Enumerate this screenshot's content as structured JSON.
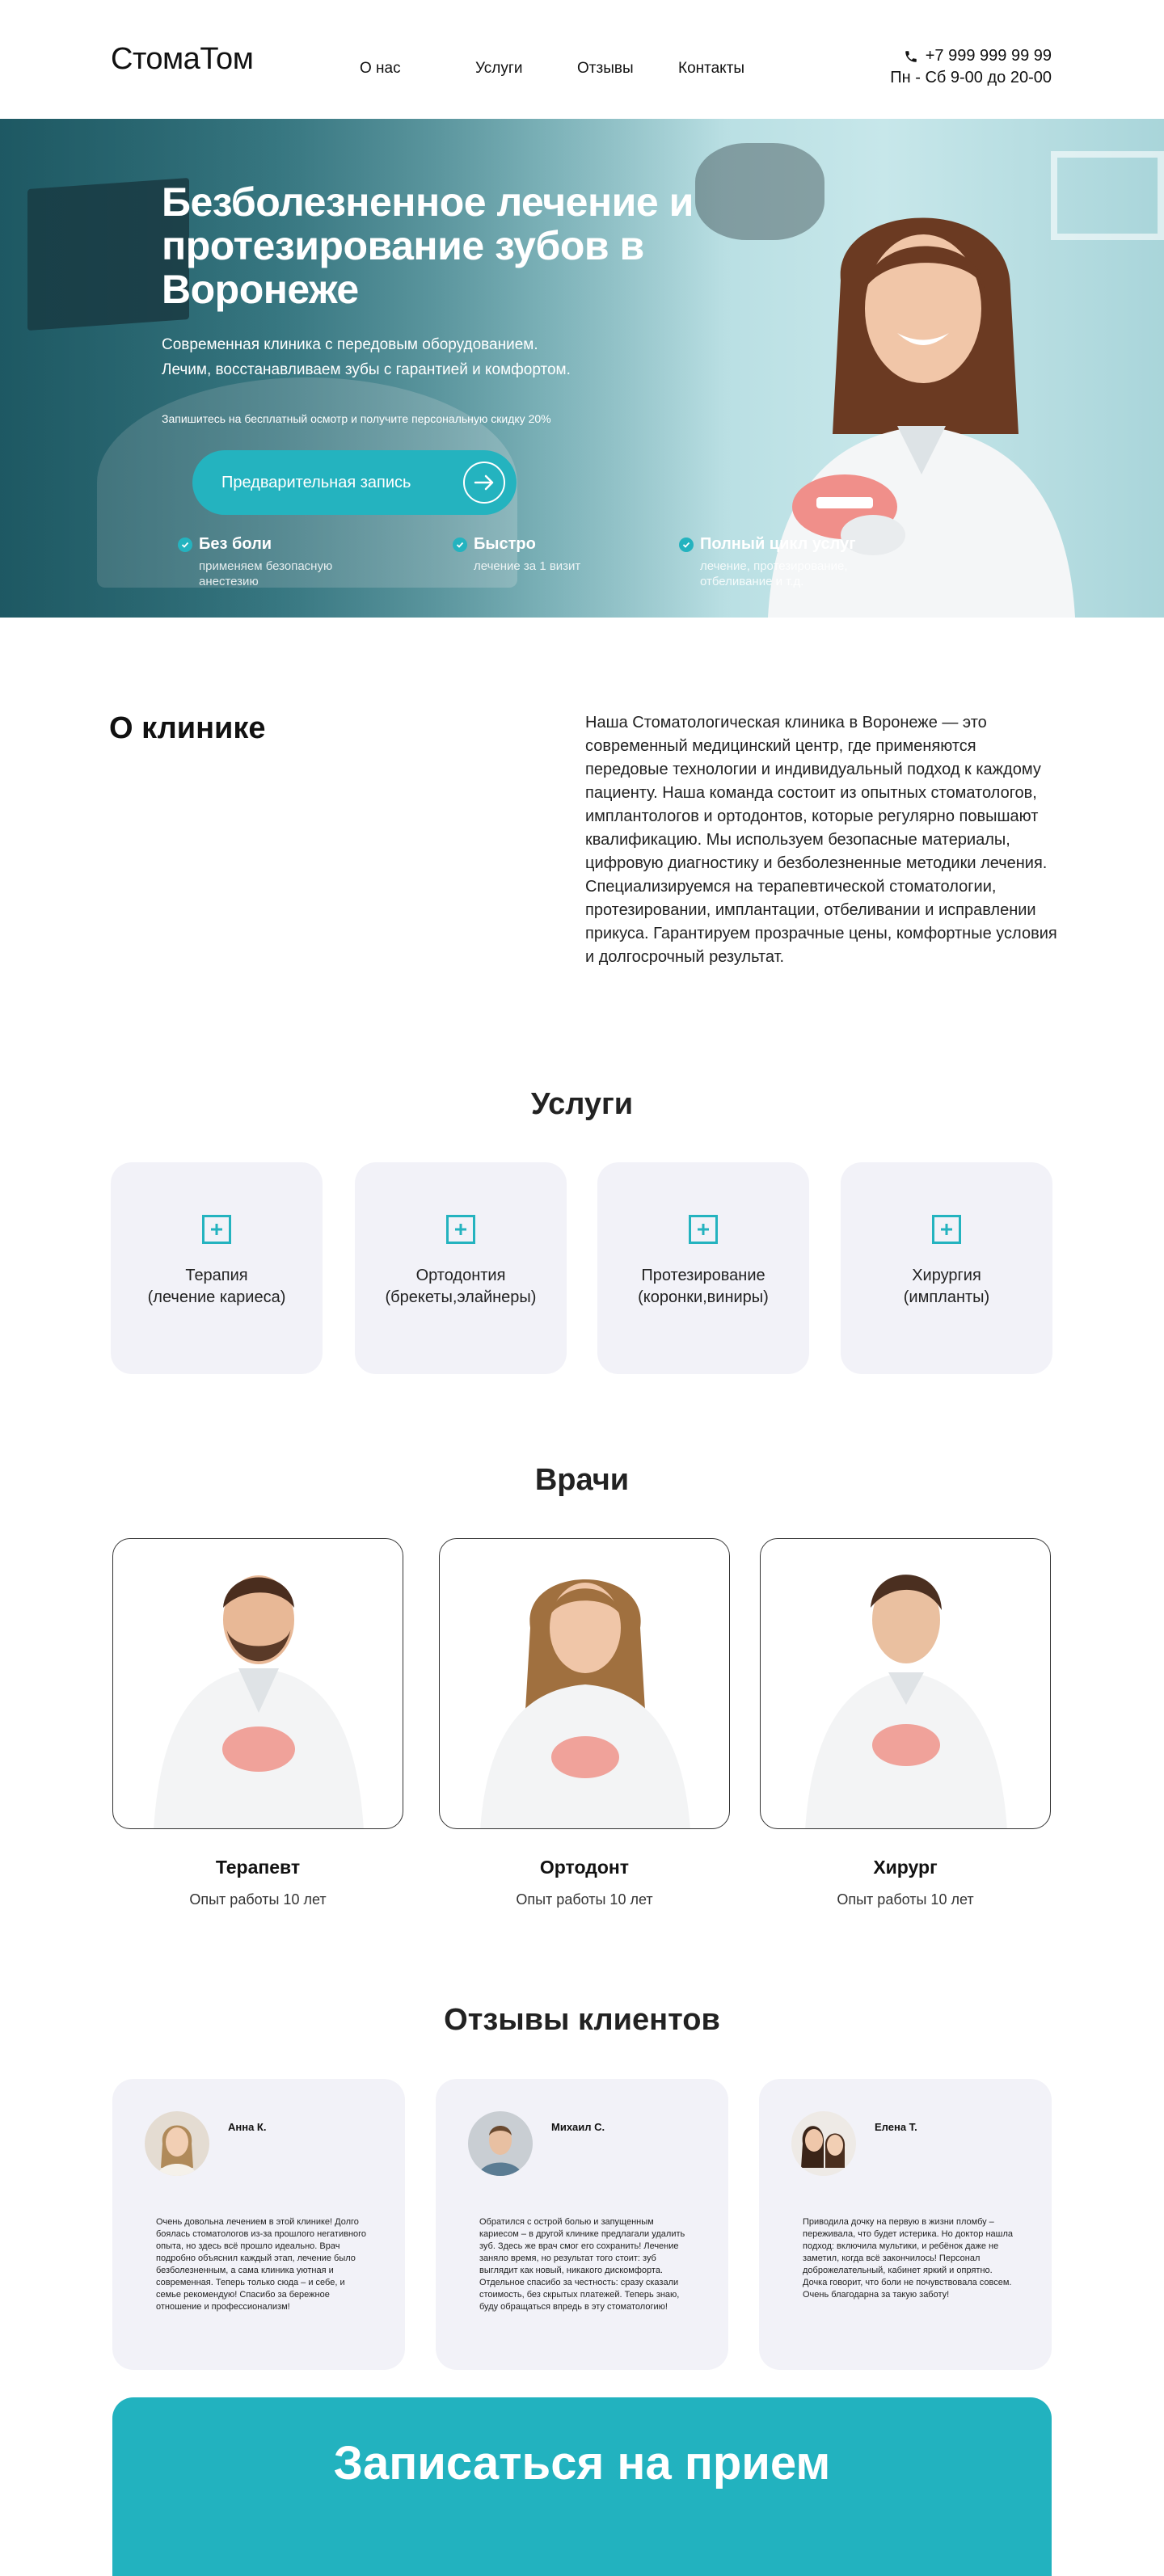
{
  "header": {
    "logo": "СтомаТом",
    "nav": [
      {
        "label": "О нас"
      },
      {
        "label": "Услуги"
      },
      {
        "label": "Отзывы"
      },
      {
        "label": "Контакты"
      }
    ],
    "phone": "+7 999 999 99 99",
    "hours": "Пн - Сб 9-00 до 20-00"
  },
  "hero": {
    "title": "Безболезненное лечение и протезирование зубов в Воронеже",
    "subtitle_line1": "Современная клиника с передовым оборудованием.",
    "subtitle_line2": "Лечим, восстанавливаем  зубы с гарантией и комфортом.",
    "note": "Запишитесь на бесплатный осмотр и получите персональную скидку 20%",
    "cta_label": "Предварительная запись",
    "features": [
      {
        "title": "Без боли",
        "desc": "применяем безопасную анестезию"
      },
      {
        "title": "Быстро",
        "desc": "лечение за 1 визит"
      },
      {
        "title": "Полный цикл услуг",
        "desc": "лечение, протезирование, отбеливание и т.д."
      }
    ]
  },
  "about": {
    "title": "О клинике",
    "text": "Наша Стоматологическая клиника  в Воронеже — это современный медицинский центр, где применяются передовые технологии и индивидуальный подход к каждому пациенту. Наша команда состоит из опытных стоматологов, имплантологов и ортодонтов, которые регулярно повышают квалификацию. Мы используем безопасные материалы, цифровую диагностику и безболезненные методики лечения. Специализируемся на терапевтической стоматологии, протезировании, имплантации, отбеливании и исправлении прикуса. Гарантируем прозрачные цены, комфортные условия и долгосрочный результат."
  },
  "services": {
    "title": "Услуги",
    "items": [
      {
        "label": "Терапия\n(лечение кариеса)"
      },
      {
        "label": "Ортодонтия\n(брекеты,элайнеры)"
      },
      {
        "label": "Протезирование\n(коронки,виниры)"
      },
      {
        "label": "Хирургия\n(импланты)"
      }
    ]
  },
  "doctors": {
    "title": "Врачи",
    "items": [
      {
        "role": "Терапевт",
        "experience": "Опыт работы 10 лет"
      },
      {
        "role": "Ортодонт",
        "experience": "Опыт работы 10 лет"
      },
      {
        "role": "Хирург",
        "experience": "Опыт работы 10 лет"
      }
    ]
  },
  "reviews": {
    "title": "Отзывы клиентов",
    "items": [
      {
        "name": "Анна К.",
        "text": "Очень довольна лечением в этой клинике! Долго боялась стоматологов из-за прошлого негативного опыта, но здесь всё прошло идеально. Врач подробно объяснил каждый этап, лечение было безболезненным, а сама клиника уютная и современная. Теперь только сюда – и себе, и семье рекомендую! Спасибо за бережное отношение и профессионализм!"
      },
      {
        "name": "Михаил С.",
        "text": "Обратился с острой болью и запущенным кариесом – в другой клинике предлагали удалить зуб. Здесь же врач смог его сохранить! Лечение заняло время, но результат того стоит: зуб выглядит как новый, никакого дискомфорта. Отдельное спасибо за честность: сразу сказали стоимость, без скрытых платежей. Теперь знаю, буду обращаться впредь в эту стоматологию!"
      },
      {
        "name": "Елена Т.",
        "text": "Приводила дочку на первую в жизни пломбу – переживала, что будет истерика. Но доктор нашла подход: включила мультики, и ребёнок даже не заметил, когда всё закончилось! Персонал доброжелательный, кабинет яркий и опрятно. Дочка говорит, что боли не почувствовала совсем.  Очень благодарна за такую заботу!"
      }
    ]
  },
  "booking": {
    "title": "Записаться на прием"
  },
  "colors": {
    "accent": "#24b3bf",
    "card_bg": "#f2f2f8",
    "text": "#1d1d1f"
  }
}
